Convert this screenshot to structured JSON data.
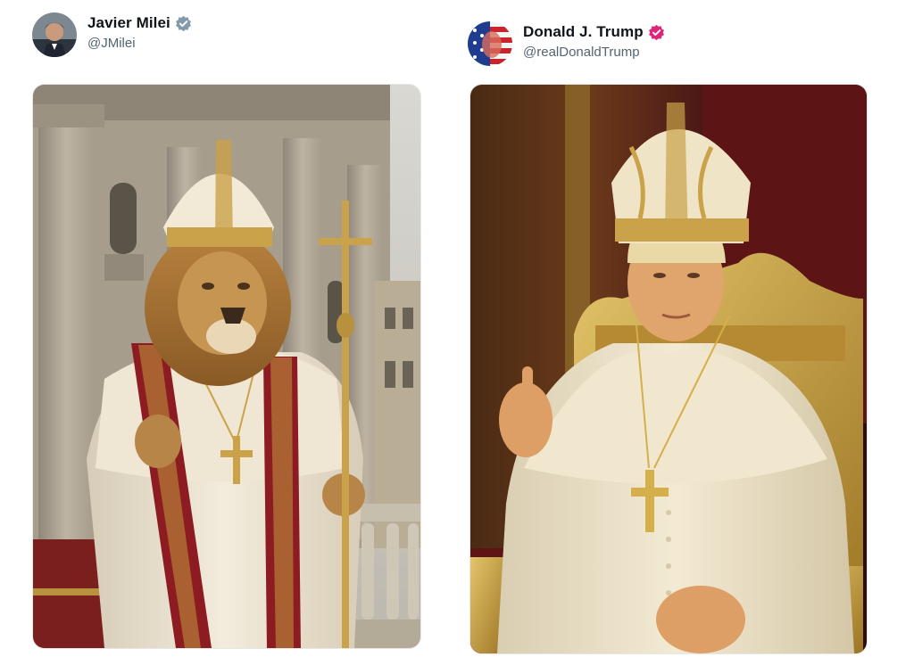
{
  "posts": [
    {
      "author": {
        "display_name": "Javier Milei",
        "handle": "@JMilei",
        "verified_badge": "blue-verified-badge-icon",
        "badge_color": "#829aab"
      },
      "media": {
        "kind": "image",
        "subject": "lion-pope-icon"
      }
    },
    {
      "author": {
        "display_name": "Donald J. Trump",
        "handle": "@realDonaldTrump",
        "verified_badge": "pink-verified-badge-icon",
        "badge_color": "#e0247a"
      },
      "media": {
        "kind": "image",
        "subject": "pope-portrait-icon"
      }
    }
  ]
}
